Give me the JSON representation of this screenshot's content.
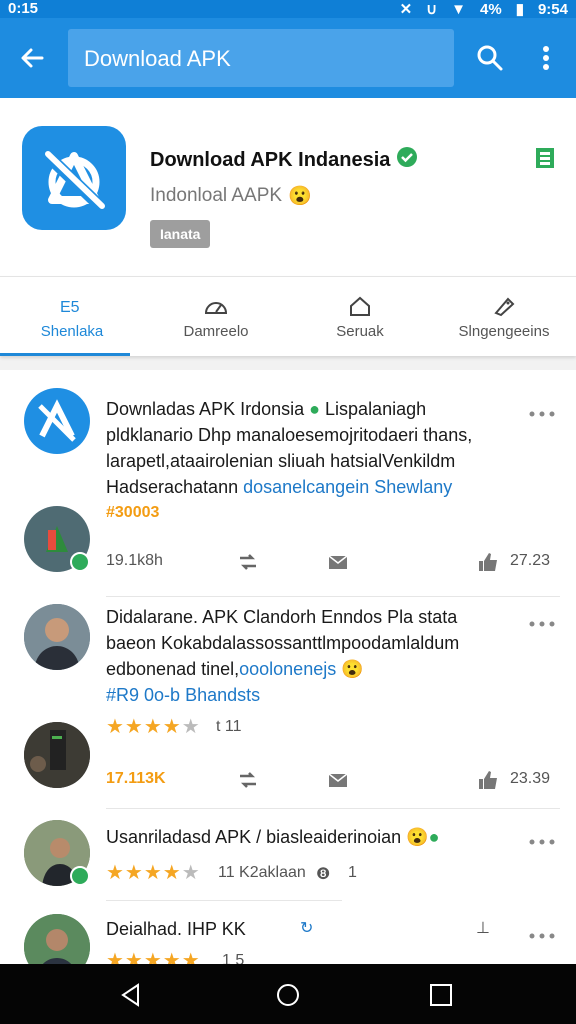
{
  "status": {
    "time_left": "0:15",
    "battery": "4%",
    "time_right": "9:54"
  },
  "app_bar": {
    "search_value": "Download APK",
    "colors": {
      "bar": "#1e8ce0",
      "search_bg": "#4aa3ea"
    }
  },
  "app": {
    "name": "Download APK Indanesia",
    "subtitle": "Indonloal AAPK",
    "badge": "Ianata",
    "emoji": "😮"
  },
  "tabs": [
    {
      "label": "Shenlaka",
      "icon": "grid-icon",
      "active": true
    },
    {
      "label": "Damreelo",
      "icon": "gauge-icon",
      "active": false
    },
    {
      "label": "Seruak",
      "icon": "home-icon",
      "active": false
    },
    {
      "label": "Slngengeeins",
      "icon": "tag-icon",
      "active": false
    }
  ],
  "posts": [
    {
      "title": "Downladas APK Irdonsia",
      "title_after": "Lispalaniagh",
      "line2": "pldklanario Dhp manaloesemojritodaeri thans,",
      "line3": "larapetl,ataairolenian sliuah hatsialVenkildm",
      "line4": "Hadserachatann",
      "line4_link": "dosanelcangein Shewlany",
      "tag": "#30003",
      "reposts": "19.1k8h",
      "likes": "27.23"
    },
    {
      "title": "Didalarane. APK Clandorh Enndos Pla stata",
      "line2": "baeon Kokabdalassossanttlmpoodamlaldum",
      "line3": "edbonenad tinel,",
      "line3_link": "ooolonenejs",
      "line4": "#R9 0o-b",
      "line4_link": "Bhandsts",
      "rating_note": "t 11",
      "reposts": "17.113K",
      "likes": "23.39"
    },
    {
      "title": "Usanriladasd APK / biasleaiderinoian",
      "rating_note": "11 K2aklaan",
      "count": "1"
    },
    {
      "title": "Deialhad. IHP KK",
      "rating_note": "1 5"
    }
  ]
}
